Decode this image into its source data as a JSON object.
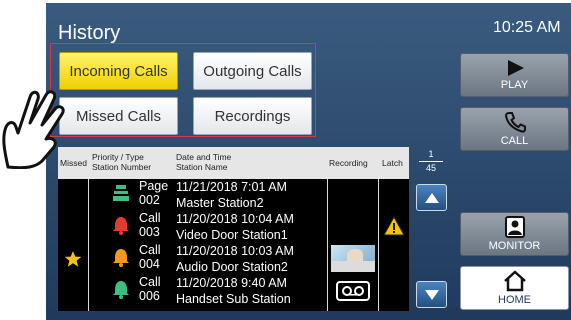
{
  "header": {
    "title": "History",
    "clock": "10:25 AM"
  },
  "filters": [
    {
      "label": "Incoming Calls",
      "active": true
    },
    {
      "label": "Outgoing Calls",
      "active": false
    },
    {
      "label": "Missed Calls",
      "active": false
    },
    {
      "label": "Recordings",
      "active": false
    }
  ],
  "side_buttons": {
    "play": "PLAY",
    "call": "CALL",
    "monitor": "MONITOR",
    "home": "HOME"
  },
  "table": {
    "headers": {
      "missed": "Missed",
      "priority_line1": "Priority / Type",
      "priority_line2": "Station Number",
      "datetime_line1": "Date and Time",
      "datetime_line2": "Station Name",
      "recording": "Recording",
      "latch": "Latch"
    },
    "rows": [
      {
        "type": "Page",
        "number": "002",
        "date": "11/21/2018  7:01 AM",
        "station": "Master Station2",
        "missed": false,
        "icon": "page-icon",
        "icon_color": "#3fbf7f"
      },
      {
        "type": "Call",
        "number": "003",
        "date": "11/20/2018 10:04 AM",
        "station": "Video Door Station1",
        "missed": false,
        "icon": "bell-icon",
        "icon_color": "#e53b2c",
        "latch": "warning-icon"
      },
      {
        "type": "Call",
        "number": "004",
        "date": "11/20/2018 10:03 AM",
        "station": "Audio Door Station2",
        "missed": true,
        "icon": "bell-icon",
        "icon_color": "#f29a1a",
        "recording": "video-thumbnail"
      },
      {
        "type": "Call",
        "number": "006",
        "date": "11/20/2018  9:40 AM",
        "station": "Handset Sub Station",
        "missed": false,
        "icon": "bell-icon",
        "icon_color": "#3fbf7f",
        "recording": "tape-icon"
      }
    ]
  },
  "pager": {
    "current": "1",
    "total": "45"
  },
  "colors": {
    "active_filter": "#f0d000",
    "accent_border": "#d23a48",
    "screen_bg": "#2b4a6e"
  }
}
